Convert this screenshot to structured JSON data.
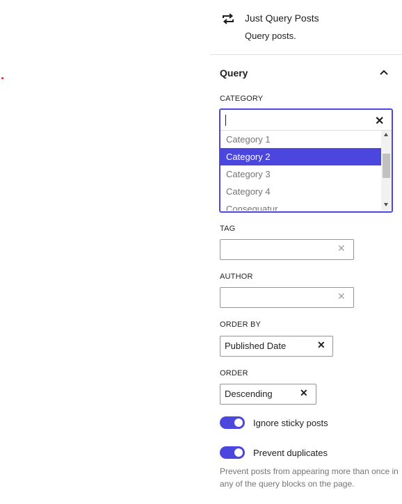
{
  "block": {
    "icon": "loop-icon",
    "title": "Just Query Posts",
    "description": "Query posts."
  },
  "section": {
    "title": "Query"
  },
  "category": {
    "label": "CATEGORY",
    "options": [
      "Category 1",
      "Category 2",
      "Category 3",
      "Category 4",
      "Consequatur"
    ],
    "selected": "Category 2"
  },
  "tag": {
    "label": "TAG",
    "value": ""
  },
  "author": {
    "label": "AUTHOR",
    "value": ""
  },
  "order_by": {
    "label": "ORDER BY",
    "value": "Published Date"
  },
  "order": {
    "label": "ORDER",
    "value": "Descending"
  },
  "toggles": {
    "ignore_sticky": {
      "label": "Ignore sticky posts",
      "on": true
    },
    "prevent_duplicates": {
      "label": "Prevent duplicates",
      "on": true
    }
  },
  "help_text": "Prevent posts from appearing more than once in any of the query blocks on the page.",
  "colors": {
    "accent": "#4b46de",
    "muted": "#757575",
    "border": "#949494"
  }
}
